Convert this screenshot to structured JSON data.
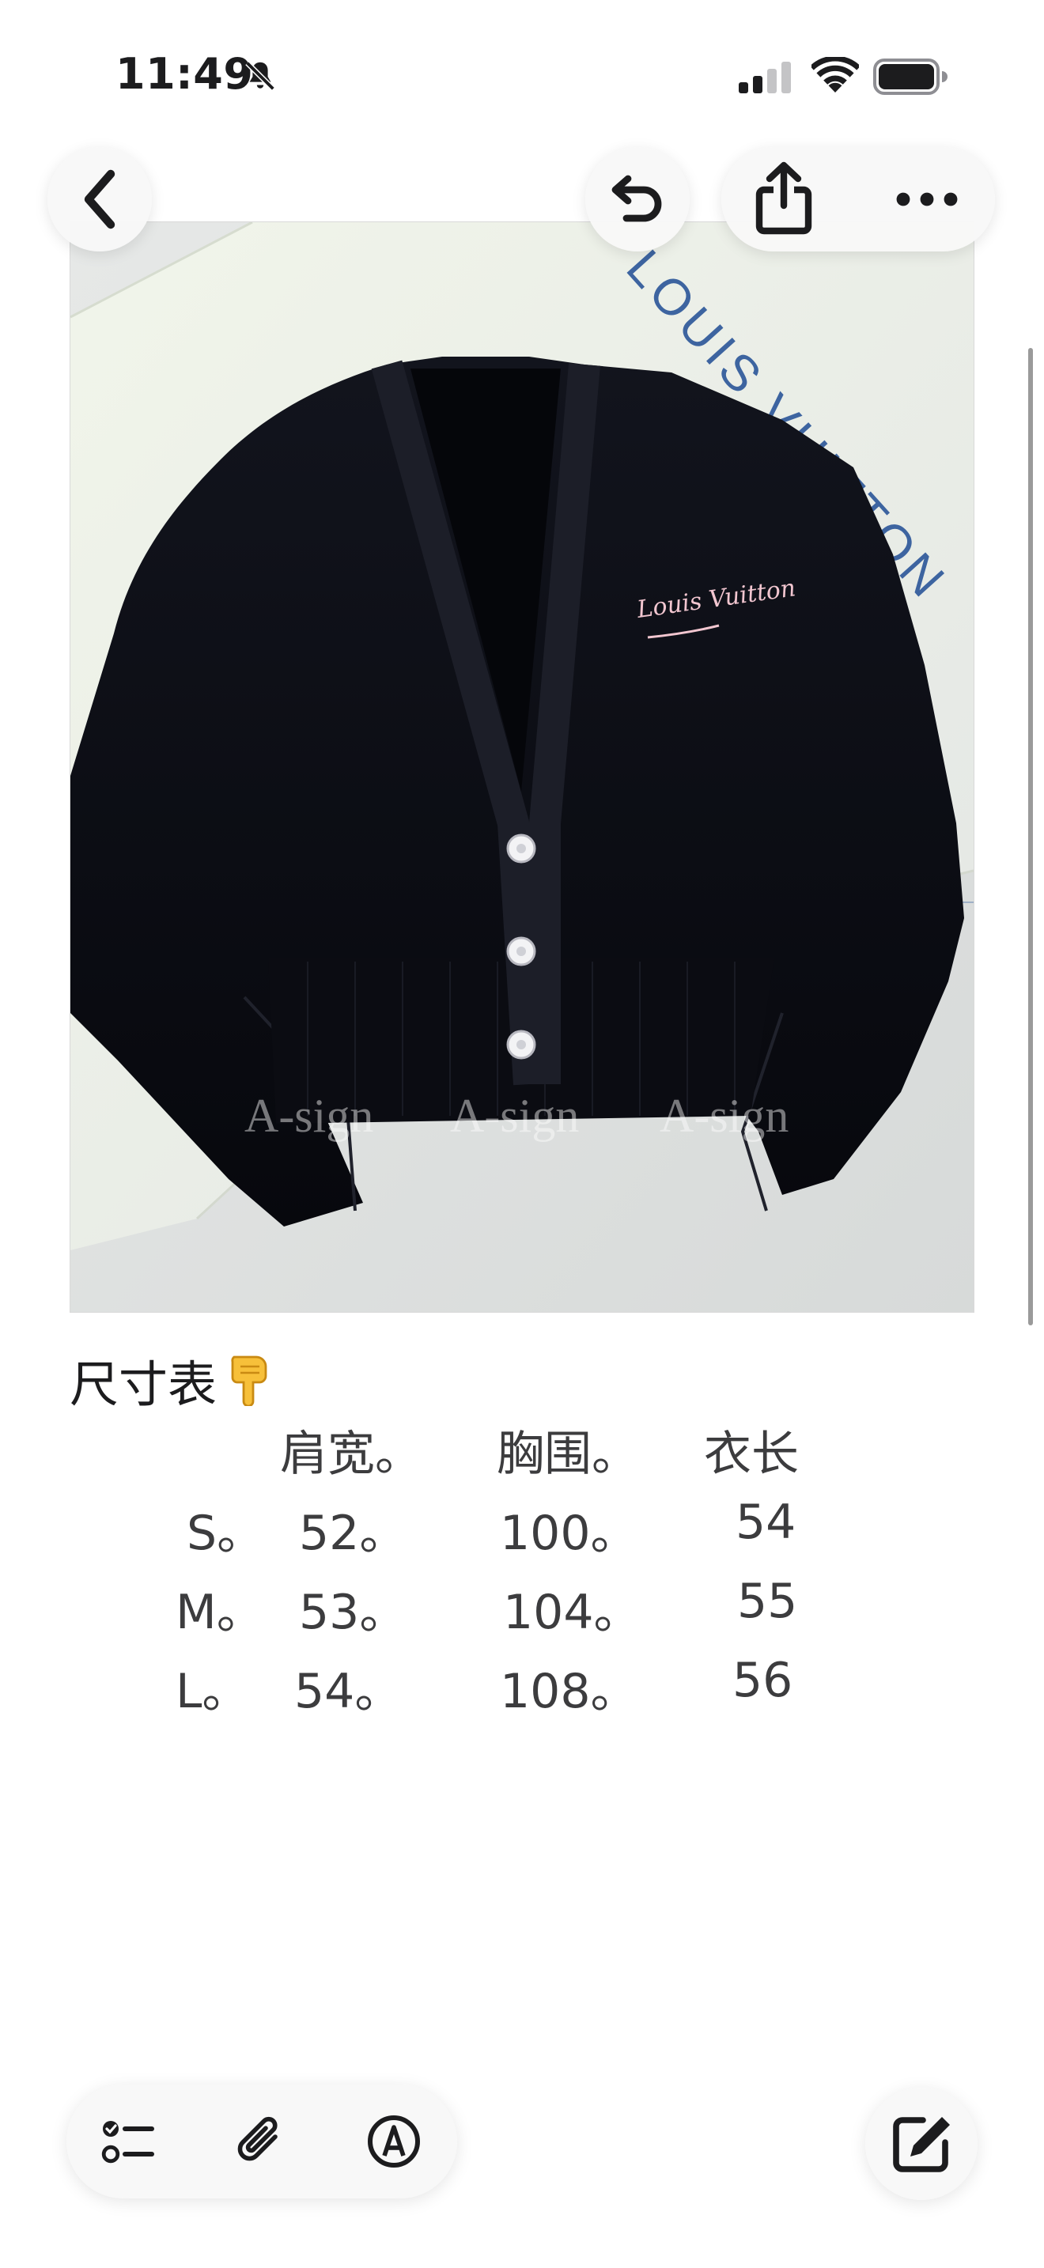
{
  "status_bar": {
    "time": "11:49",
    "silent_icon": "bell-slash-icon",
    "signal_icon": "cellular-signal-icon",
    "wifi_icon": "wifi-icon",
    "battery_icon": "battery-icon"
  },
  "nav": {
    "back_icon": "chevron-left-icon",
    "undo_icon": "undo-icon",
    "share_icon": "share-icon",
    "more_icon": "ellipsis-icon"
  },
  "note": {
    "photo": {
      "brand_text": "LOUIS VUITTON",
      "logo_text": "Louis Vuitton",
      "watermarks": [
        "A-sign",
        "A-sign",
        "A-sign"
      ]
    },
    "heading": "尺寸表",
    "heading_emoji": "👇",
    "size_table": {
      "headers": [
        "肩宽。",
        "胸围。",
        "衣长"
      ],
      "rows": [
        {
          "size": "S。",
          "shoulder": "52。",
          "chest": "100。",
          "length": "54"
        },
        {
          "size": "M。",
          "shoulder": "53。",
          "chest": "104。",
          "length": "55"
        },
        {
          "size": "L。",
          "shoulder": "54。",
          "chest": "108。",
          "length": "56"
        }
      ]
    }
  },
  "toolbar": {
    "checklist_icon": "checklist-icon",
    "attachment_icon": "paperclip-icon",
    "markup_icon": "markup-pen-icon",
    "compose_icon": "compose-icon"
  },
  "colors": {
    "accent": "#1c1c1e",
    "background": "#ffffff",
    "cardigan": "#0d0f17",
    "logo_pink": "#f2c6d0",
    "lv_blue": "#2e5a9a"
  }
}
